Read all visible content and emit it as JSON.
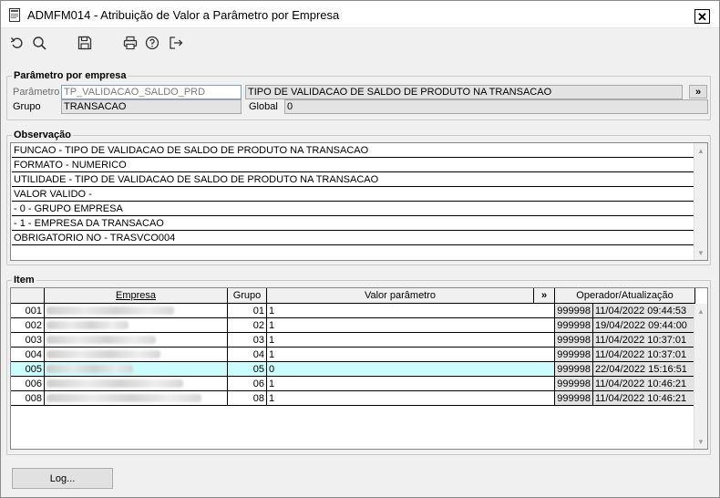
{
  "window": {
    "title": "ADMFM014 - Atribuição de Valor a Parâmetro por Empresa",
    "close_glyph": "✕"
  },
  "toolbar": {
    "icons": [
      "undo-icon",
      "search-icon",
      "save-icon",
      "print-icon",
      "help-icon",
      "exit-icon"
    ]
  },
  "param_group": {
    "legend": "Parâmetro por empresa",
    "parametro_label": "Parâmetro",
    "parametro_value": "TP_VALIDACAO_SALDO_PRD",
    "parametro_desc": "TIPO DE VALIDACAO DE SALDO DE PRODUTO NA TRANSACAO",
    "more_button": "»",
    "grupo_label": "Grupo",
    "grupo_value": "TRANSACAO",
    "global_label": "Global",
    "global_value": "0"
  },
  "obs_group": {
    "legend": "Observação",
    "lines": [
      "FUNCAO - TIPO DE VALIDACAO DE SALDO DE PRODUTO NA TRANSACAO",
      "FORMATO - NUMERICO",
      "UTILIDADE - TIPO DE VALIDACAO DE SALDO DE PRODUTO NA TRANSACAO",
      "VALOR VALIDO -",
      "- 0 - GRUPO EMPRESA",
      "- 1 - EMPRESA DA TRANSACAO",
      "OBRIGATORIO NO - TRASVCO004"
    ]
  },
  "item_group": {
    "legend": "Item",
    "headers": {
      "empresa": "Empresa",
      "grupo": "Grupo",
      "valor": "Valor parâmetro",
      "more": "»",
      "operador": "Operador/Atualização"
    },
    "rows": [
      {
        "code": "001",
        "grupo": "01",
        "valor": "1",
        "operador": "999998",
        "data": "11/04/2022 09:44:53",
        "selected": false
      },
      {
        "code": "002",
        "grupo": "02",
        "valor": "1",
        "operador": "999998",
        "data": "19/04/2022 09:44:00",
        "selected": false
      },
      {
        "code": "003",
        "grupo": "03",
        "valor": "1",
        "operador": "999998",
        "data": "11/04/2022 10:37:01",
        "selected": false
      },
      {
        "code": "004",
        "grupo": "04",
        "valor": "1",
        "operador": "999998",
        "data": "11/04/2022 10:37:01",
        "selected": false
      },
      {
        "code": "005",
        "grupo": "05",
        "valor": "0",
        "operador": "999998",
        "data": "22/04/2022 15:16:51",
        "selected": true
      },
      {
        "code": "006",
        "grupo": "06",
        "valor": "1",
        "operador": "999998",
        "data": "11/04/2022 10:46:21",
        "selected": false
      },
      {
        "code": "008",
        "grupo": "08",
        "valor": "1",
        "operador": "999998",
        "data": "11/04/2022 10:46:21",
        "selected": false
      }
    ]
  },
  "footer": {
    "log_button": "Log..."
  }
}
